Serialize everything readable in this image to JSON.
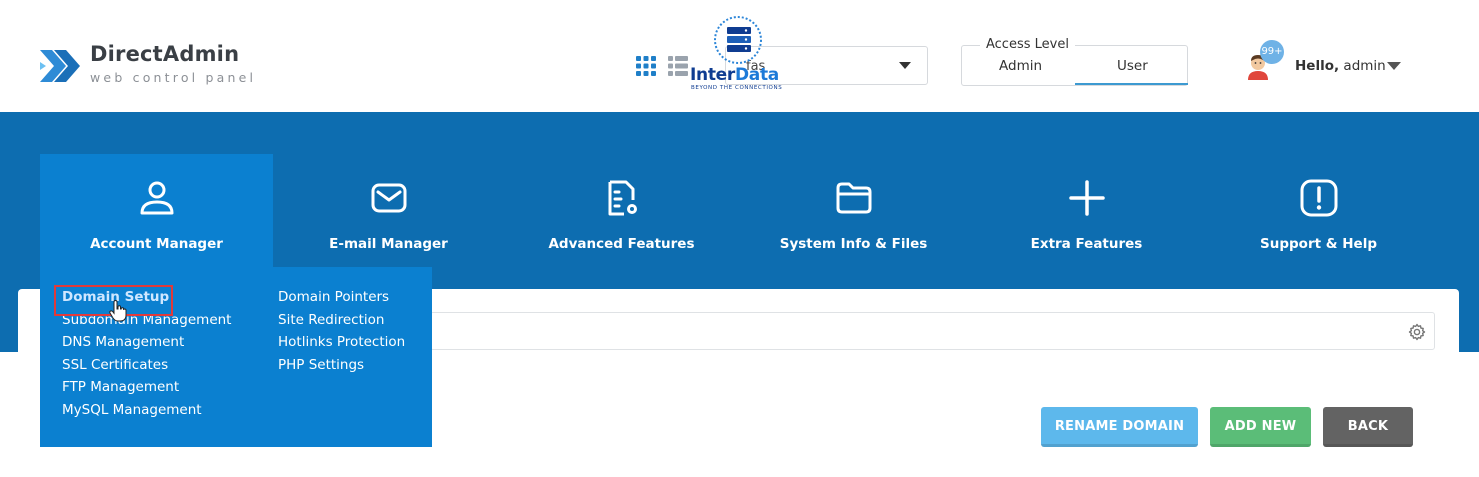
{
  "header": {
    "logo": {
      "title": "DirectAdmin",
      "subtitle": "web control panel"
    },
    "overlay_logo": {
      "text_dark": "Inter",
      "text_light": "Data",
      "tagline": "BEYOND THE CONNECTIONS"
    },
    "selector": {
      "value": "fas"
    },
    "access_level": {
      "legend": "Access Level",
      "options": [
        "Admin",
        "User"
      ],
      "selected": "User"
    },
    "user": {
      "badge": "99+",
      "greeting": "Hello,",
      "name": "admin"
    }
  },
  "nav": {
    "items": [
      {
        "label": "Account Manager",
        "icon": "user-icon",
        "active": true
      },
      {
        "label": "E-mail Manager",
        "icon": "envelope-icon"
      },
      {
        "label": "Advanced Features",
        "icon": "document-gear-icon"
      },
      {
        "label": "System Info & Files",
        "icon": "folder-icon"
      },
      {
        "label": "Extra Features",
        "icon": "plus-icon"
      },
      {
        "label": "Support & Help",
        "icon": "exclamation-icon"
      }
    ]
  },
  "dropdown": {
    "col1": [
      "Domain Setup",
      "Subdomain Management",
      "DNS Management",
      "SSL Certificates",
      "FTP Management",
      "MySQL Management"
    ],
    "col2": [
      "Domain Pointers",
      "Site Redirection",
      "Hotlinks Protection",
      "PHP Settings"
    ]
  },
  "actions": {
    "rename": "RENAME DOMAIN",
    "add_new": "ADD NEW",
    "back": "BACK"
  },
  "colors": {
    "banner": "#0d6db0",
    "nav_active": "#0b80d0",
    "rename_button": "#5db8ec",
    "add_button": "#5bbd78",
    "back_button": "#636363",
    "highlight_border": "#e23a3a"
  }
}
